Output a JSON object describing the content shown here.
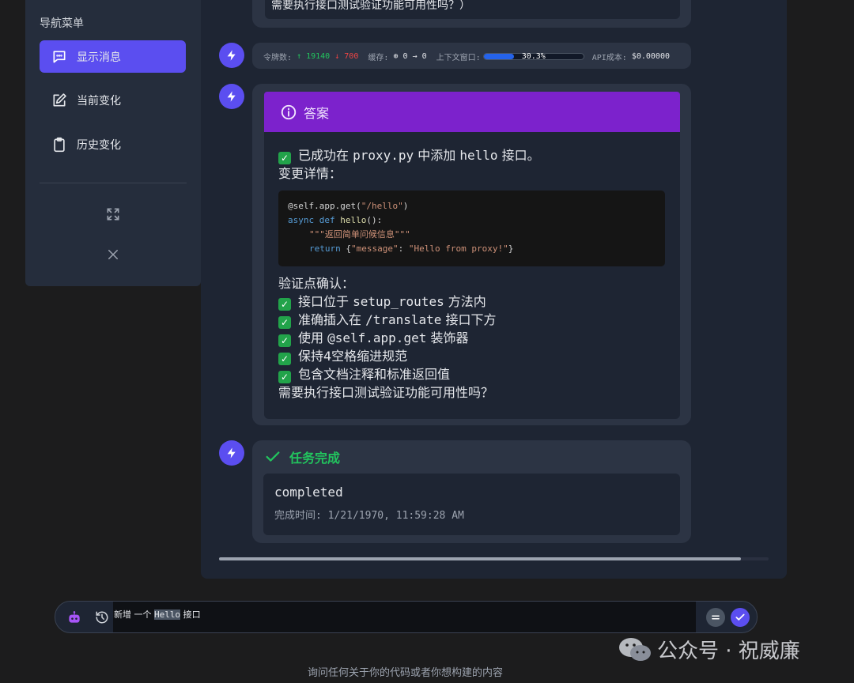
{
  "sidebar": {
    "title": "导航菜单",
    "items": [
      {
        "label": "显示消息",
        "icon": "message-icon",
        "active": true
      },
      {
        "label": "当前变化",
        "icon": "edit-icon",
        "active": false
      },
      {
        "label": "历史变化",
        "icon": "clipboard-icon",
        "active": false
      }
    ],
    "actions": [
      "expand-icon",
      "close-icon"
    ]
  },
  "messages": {
    "top_partial": "需要执行接口测试验证功能可用性吗？）",
    "stats": {
      "tokens_label": "令牌数:",
      "tokens_up": "↑ 19140",
      "tokens_down": "↓ 700",
      "cache_label": "缓存:",
      "cache_value": "⊕ 0 → 0",
      "context_label": "上下文窗口:",
      "context_pct": "30.3%",
      "context_fraction": 0.303,
      "cost_label": "API成本:",
      "cost_value": "$0.00000"
    },
    "answer": {
      "header": "答案",
      "line1_pre": "已成功在",
      "line1_code": "proxy.py",
      "line1_mid": "中添加",
      "line1_code2": "hello",
      "line1_post": "接口。",
      "details_label": "变更详情：",
      "code": {
        "decorator": "@self.app.get(",
        "route": "\"/hello\"",
        "close_paren": ")",
        "kw_async": "async",
        "kw_def": "def",
        "fn_name": "hello",
        "fn_sig": "():",
        "docstring": "\"\"\"返回简单问候信息\"\"\"",
        "kw_return": "return",
        "ret_open": "{",
        "ret_key": "\"message\"",
        "ret_colon": ": ",
        "ret_val": "\"Hello from proxy!\"",
        "ret_close": "}"
      },
      "verify_label": "验证点确认：",
      "checks": [
        {
          "pre": "接口位于",
          "code": "setup_routes",
          "post": "方法内"
        },
        {
          "pre": "准确插入在",
          "code": "/translate",
          "post": "接口下方"
        },
        {
          "pre": "使用",
          "code": "@self.app.get",
          "post": "装饰器"
        },
        {
          "pre": "保持4空格缩进规范",
          "code": "",
          "post": ""
        },
        {
          "pre": "包含文档注释和标准返回值",
          "code": "",
          "post": ""
        }
      ],
      "question": "需要执行接口测试验证功能可用性吗？"
    },
    "done": {
      "header": "任务完成",
      "status": "completed",
      "time_label": "完成时间:",
      "time_value": "1/21/1970, 11:59:28 AM"
    }
  },
  "input": {
    "pre": "新增 一个",
    "highlight": "Hello",
    "post": "接口"
  },
  "footer_hint": "询问任何关于你的代码或者你想构建的内容",
  "watermark": "公众号 · 祝威廉",
  "colors": {
    "accent": "#5b4ef0",
    "answer_header": "#7c22cc",
    "success": "#22c55e"
  }
}
